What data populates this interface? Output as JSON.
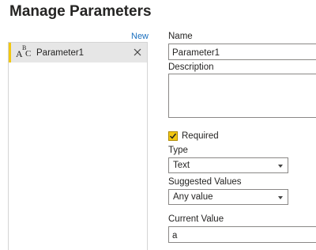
{
  "dialog": {
    "title": "Manage Parameters"
  },
  "list": {
    "new_label": "New",
    "items": [
      {
        "label": "Parameter1",
        "icon": "text-type-abc-icon"
      }
    ]
  },
  "form": {
    "name_label": "Name",
    "name_value": "Parameter1",
    "description_label": "Description",
    "description_value": "",
    "required_label": "Required",
    "required_checked": true,
    "type_label": "Type",
    "type_value": "Text",
    "suggested_label": "Suggested Values",
    "suggested_value": "Any value",
    "current_label": "Current Value",
    "current_value": "a"
  },
  "colors": {
    "accent": "#f2c811",
    "link": "#1a6fbf",
    "selected_bg": "#e6e6e6",
    "border": "#8a8886"
  }
}
